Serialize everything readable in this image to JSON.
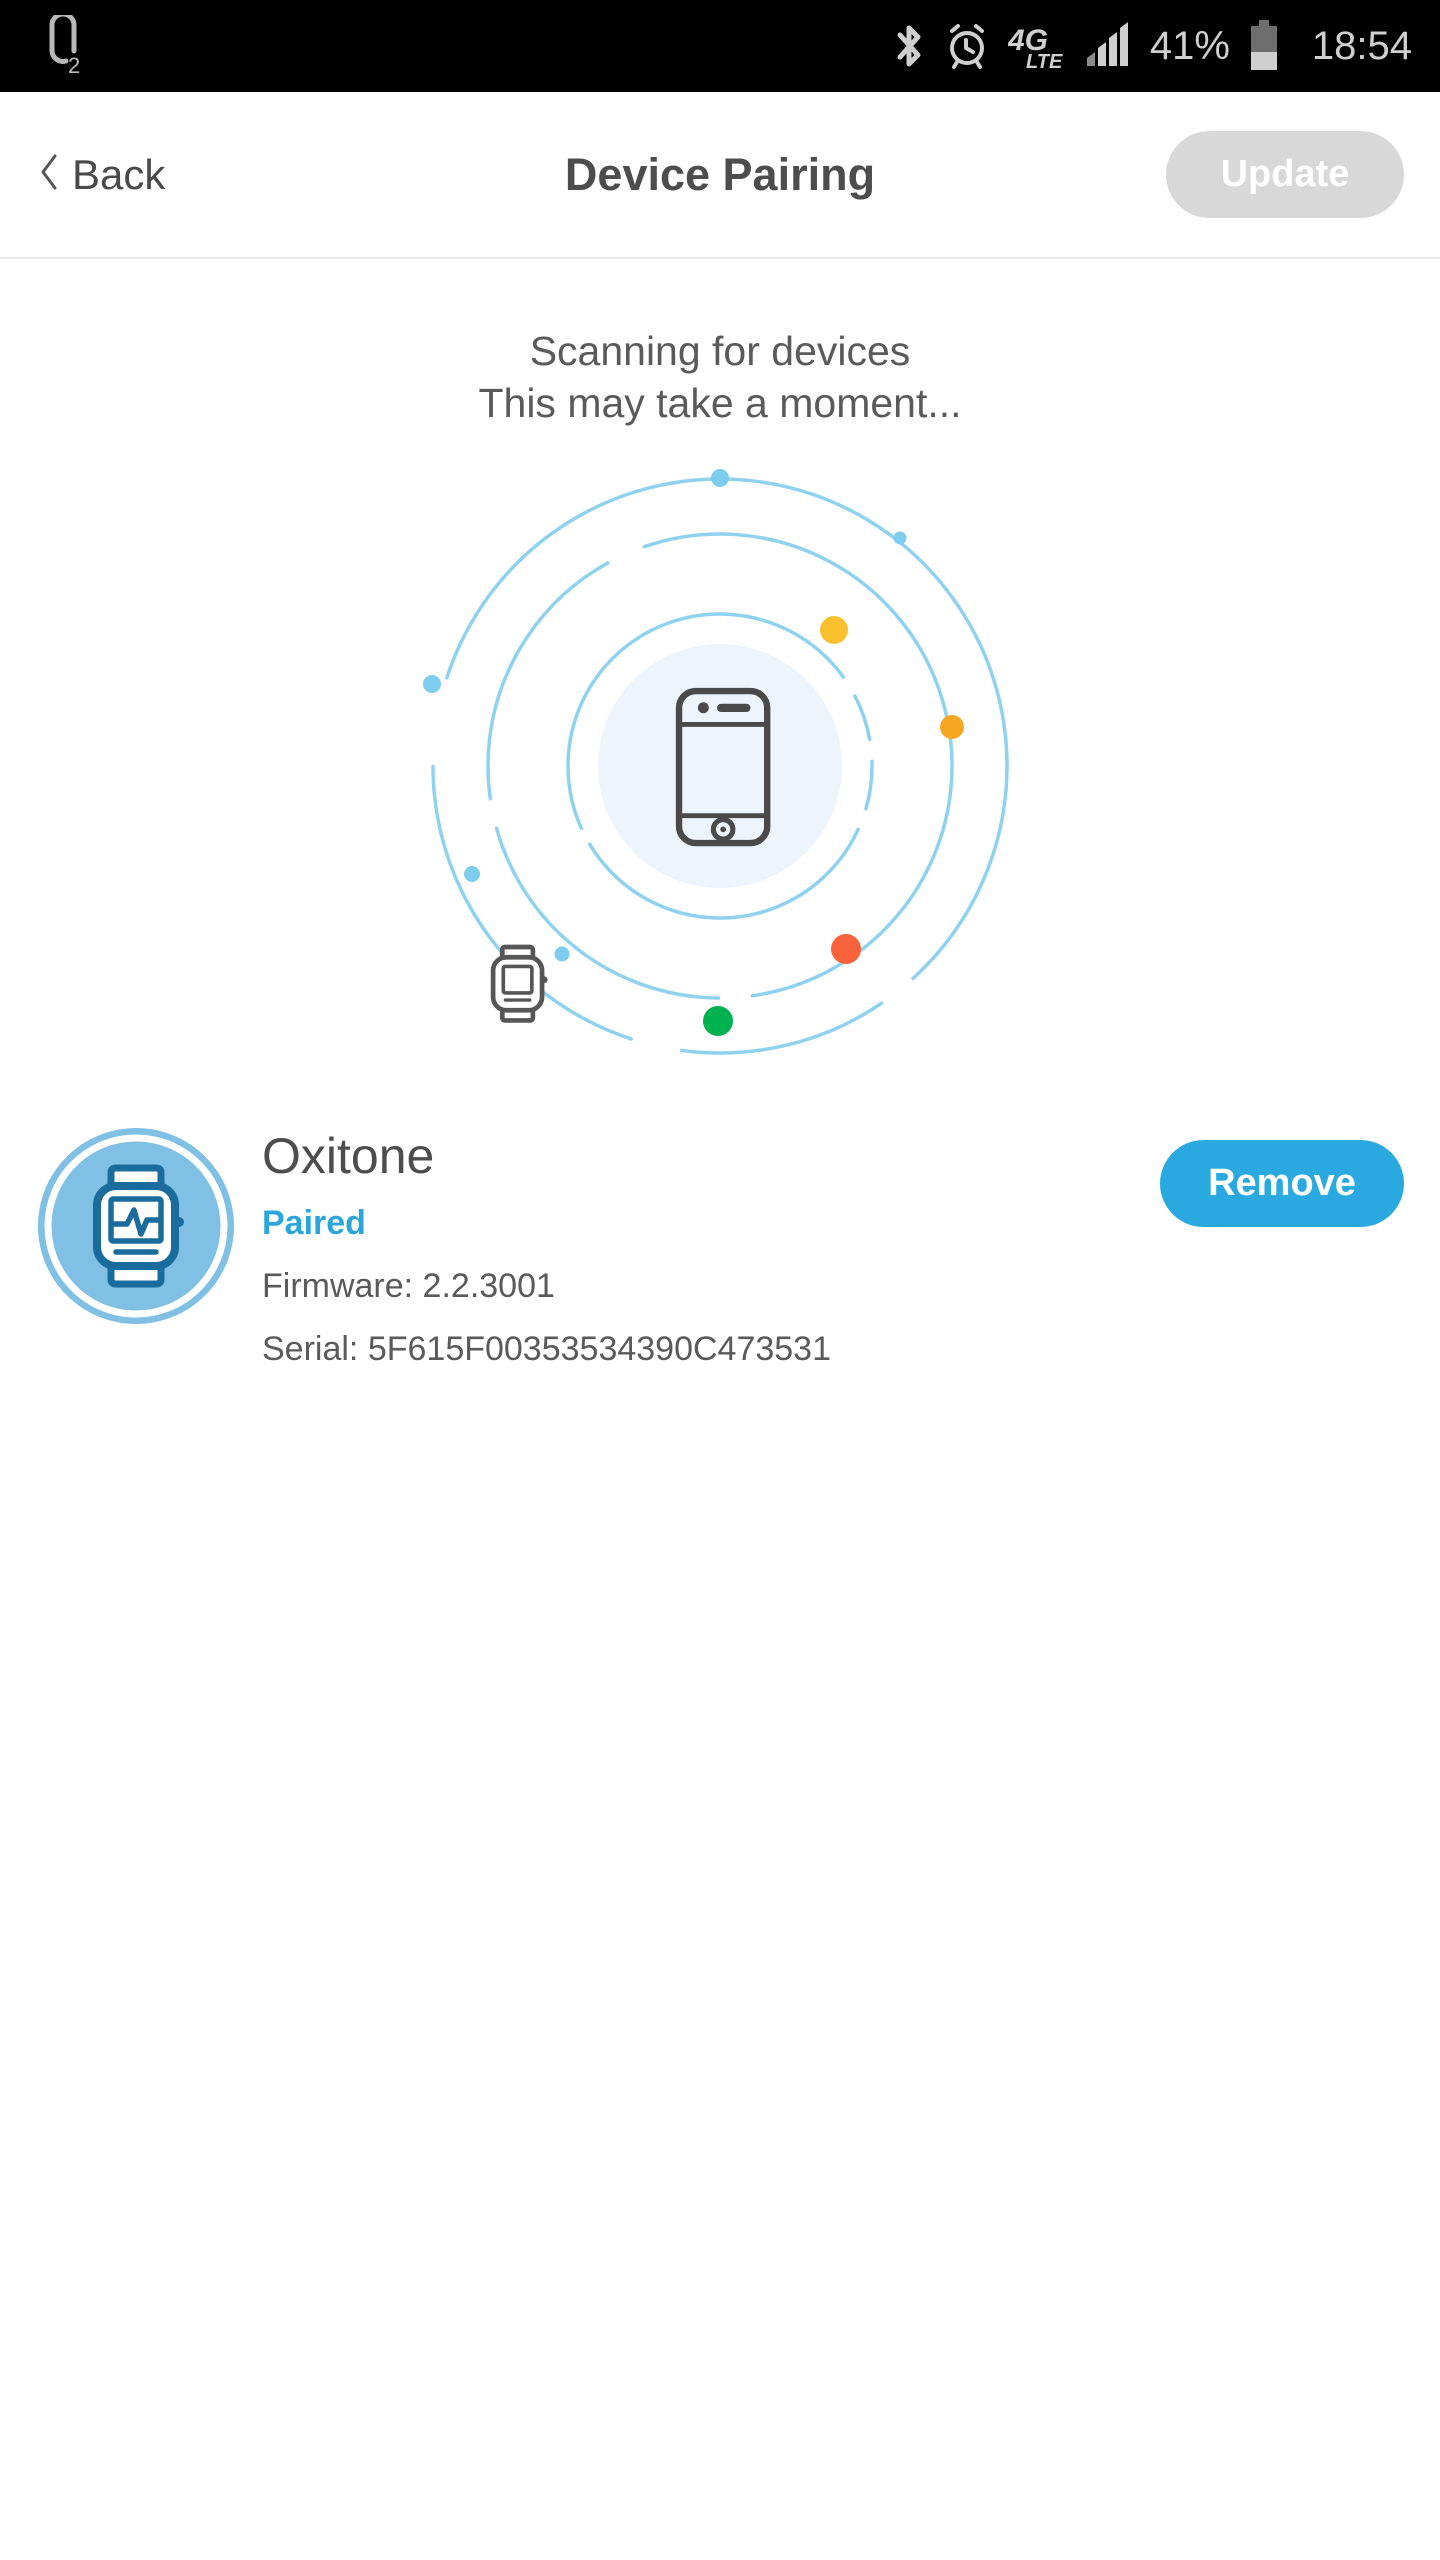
{
  "status_bar": {
    "carrier_icon": "o2-logo-icon",
    "bluetooth_icon": "bluetooth-icon",
    "alarm_icon": "alarm-clock-icon",
    "network_label": "4G",
    "network_sub_label": "LTE",
    "signal_icon": "signal-bars-icon",
    "battery_percent": "41%",
    "battery_icon": "battery-icon",
    "time": "18:54"
  },
  "header": {
    "back_label": "Back",
    "back_icon": "chevron-left-icon",
    "title": "Device Pairing",
    "update_label": "Update",
    "update_enabled": false
  },
  "scan": {
    "line1": "Scanning for devices",
    "line2": "This may take a moment...",
    "center_icon": "smartphone-icon",
    "peripheral_icon": "smartwatch-icon",
    "dot_colors": {
      "yellow": "#fbc02d",
      "orange": "#f5a623",
      "red": "#f9633b",
      "green": "#00b14f",
      "light_blue": "#7fcdee"
    },
    "ring_color": "#8ed2ef",
    "center_disc_color": "#eef4fb"
  },
  "device": {
    "avatar_icon": "smartwatch-heartbeat-icon",
    "avatar_bg_color": "#7fc0e4",
    "avatar_icon_color": "#1a6c9c",
    "name": "Oxitone",
    "status": "Paired",
    "status_color": "#2ba6dd",
    "firmware": "Firmware: 2.2.3001",
    "serial": "Serial: 5F615F00353534390C473531",
    "remove_label": "Remove",
    "remove_color": "#29a9e0"
  }
}
